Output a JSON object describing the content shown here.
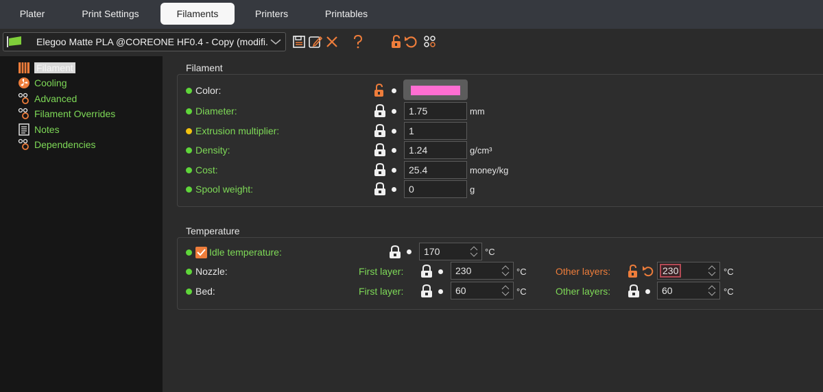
{
  "tabs": [
    {
      "label": "Plater"
    },
    {
      "label": "Print Settings"
    },
    {
      "label": "Filaments",
      "active": true
    },
    {
      "label": "Printers"
    },
    {
      "label": "Printables"
    }
  ],
  "preset": {
    "name": "Elegoo Matte PLA @COREONE HF0.4 - Copy (modifi..."
  },
  "toolbar_icons": [
    "save-icon",
    "rename-icon",
    "delete-icon",
    "help-icon",
    "unlock-icon",
    "undo-icon",
    "compare-icon"
  ],
  "sidebar": {
    "items": [
      {
        "label": "Filament",
        "icon": "filament-icon",
        "selected": true
      },
      {
        "label": "Cooling",
        "icon": "cooling-icon"
      },
      {
        "label": "Advanced",
        "icon": "advanced-icon"
      },
      {
        "label": "Filament Overrides",
        "icon": "overrides-icon"
      },
      {
        "label": "Notes",
        "icon": "notes-icon"
      },
      {
        "label": "Dependencies",
        "icon": "dependencies-icon"
      }
    ]
  },
  "filament_section": {
    "title": "Filament",
    "color": {
      "label": "Color:",
      "value": "#ff6ed2"
    },
    "diameter": {
      "label": "Diameter:",
      "value": "1.75",
      "unit": "mm"
    },
    "extrusion_multiplier": {
      "label": "Extrusion multiplier:",
      "value": "1"
    },
    "density": {
      "label": "Density:",
      "value": "1.24",
      "unit": "g/cm³"
    },
    "cost": {
      "label": "Cost:",
      "value": "25.4",
      "unit": "money/kg"
    },
    "spool_weight": {
      "label": "Spool weight:",
      "value": "0",
      "unit": "g"
    }
  },
  "temperature_section": {
    "title": "Temperature",
    "idle": {
      "label": "Idle temperature:",
      "value": "170",
      "unit": "°C"
    },
    "nozzle": {
      "label": "Nozzle:",
      "first_label": "First layer:",
      "first_value": "230",
      "other_label": "Other layers:",
      "other_value": "230",
      "unit": "°C"
    },
    "bed": {
      "label": "Bed:",
      "first_label": "First layer:",
      "first_value": "60",
      "other_label": "Other layers:",
      "other_value": "60",
      "unit": "°C"
    }
  },
  "colors": {
    "accent_orange": "#ee7d3b",
    "label_green": "#7ed957",
    "dot_green": "#5fd63a",
    "dot_yellow": "#f2c20f"
  }
}
